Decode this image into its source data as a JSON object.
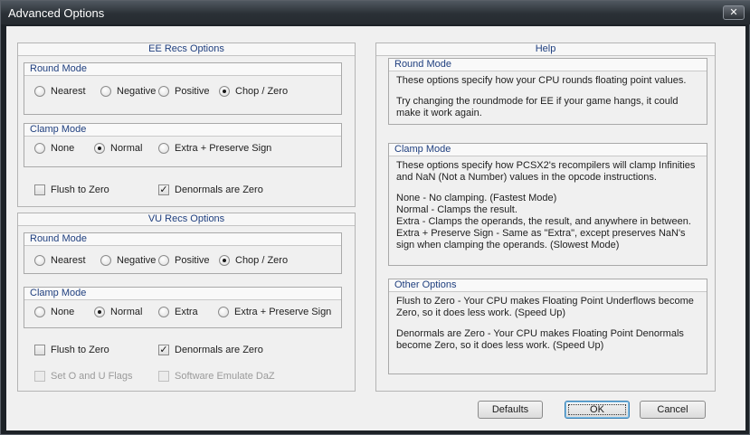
{
  "window": {
    "title": "Advanced Options",
    "close_glyph": "✕"
  },
  "ee": {
    "title": "EE Recs Options",
    "round_mode": {
      "title": "Round Mode",
      "options": [
        "Nearest",
        "Negative",
        "Positive",
        "Chop / Zero"
      ],
      "selected": "Chop / Zero"
    },
    "clamp_mode": {
      "title": "Clamp Mode",
      "options": [
        "None",
        "Normal",
        "Extra + Preserve Sign"
      ],
      "selected": "Normal"
    },
    "flush_to_zero": {
      "label": "Flush to Zero",
      "checked": false
    },
    "denormals_are_zero": {
      "label": "Denormals are Zero",
      "checked": true
    }
  },
  "vu": {
    "title": "VU Recs Options",
    "round_mode": {
      "title": "Round Mode",
      "options": [
        "Nearest",
        "Negative",
        "Positive",
        "Chop / Zero"
      ],
      "selected": "Chop / Zero"
    },
    "clamp_mode": {
      "title": "Clamp Mode",
      "options": [
        "None",
        "Normal",
        "Extra",
        "Extra + Preserve Sign"
      ],
      "selected": "Normal"
    },
    "flush_to_zero": {
      "label": "Flush to Zero",
      "checked": false
    },
    "denormals_are_zero": {
      "label": "Denormals are Zero",
      "checked": true
    },
    "set_o_u_flags": {
      "label": "Set O and U Flags",
      "checked": false,
      "enabled": false
    },
    "software_emulate_daz": {
      "label": "Software Emulate DaZ",
      "checked": false,
      "enabled": false
    }
  },
  "help": {
    "title": "Help",
    "round_mode": {
      "title": "Round Mode",
      "p1": "These options specify how your CPU rounds floating point values.",
      "p2": "Try changing the roundmode for EE if your game hangs, it could make it work again."
    },
    "clamp_mode": {
      "title": "Clamp Mode",
      "p1": "These options specify how PCSX2's recompilers will clamp Infinities and NaN (Not a Number) values in the opcode instructions.",
      "l1": "None - No clamping. (Fastest Mode)",
      "l2": "Normal - Clamps the result.",
      "l3": "Extra - Clamps the operands, the result, and anywhere in between.",
      "l4": "Extra + Preserve Sign - Same as \"Extra\", except preserves NaN's sign when clamping the operands. (Slowest Mode)"
    },
    "other_options": {
      "title": "Other Options",
      "p1": "Flush to Zero - Your CPU makes Floating Point Underflows become Zero, so it does less work. (Speed Up)",
      "p2": "Denormals are Zero - Your CPU makes Floating Point Denormals become Zero, so it does less work. (Speed Up)"
    }
  },
  "buttons": {
    "defaults": "Defaults",
    "ok": "OK",
    "cancel": "Cancel"
  },
  "check_glyph": "✓"
}
